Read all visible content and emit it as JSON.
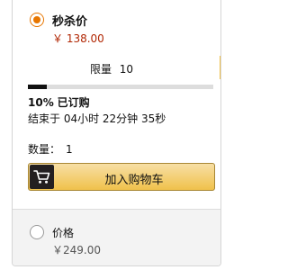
{
  "deal": {
    "title": "秒杀价",
    "price": "￥ 138.00",
    "limit_label": "限量",
    "limit_value": "10",
    "claimed_percent_text": "10%",
    "claimed_suffix": "已订购",
    "claimed_fraction": 0.1,
    "ends_text": "结束于 04小时 22分钟 35秒",
    "quantity_label": "数量：",
    "quantity_value": "1",
    "add_to_cart_label": "加入购物车"
  },
  "regular": {
    "title": "价格",
    "price": "￥249.00"
  },
  "colors": {
    "accent_orange": "#e77600",
    "price_red": "#b12704",
    "button_yellow": "#f0c14b",
    "progress_fill": "#111111"
  },
  "icons": {
    "cart": "shopping-cart-icon"
  }
}
